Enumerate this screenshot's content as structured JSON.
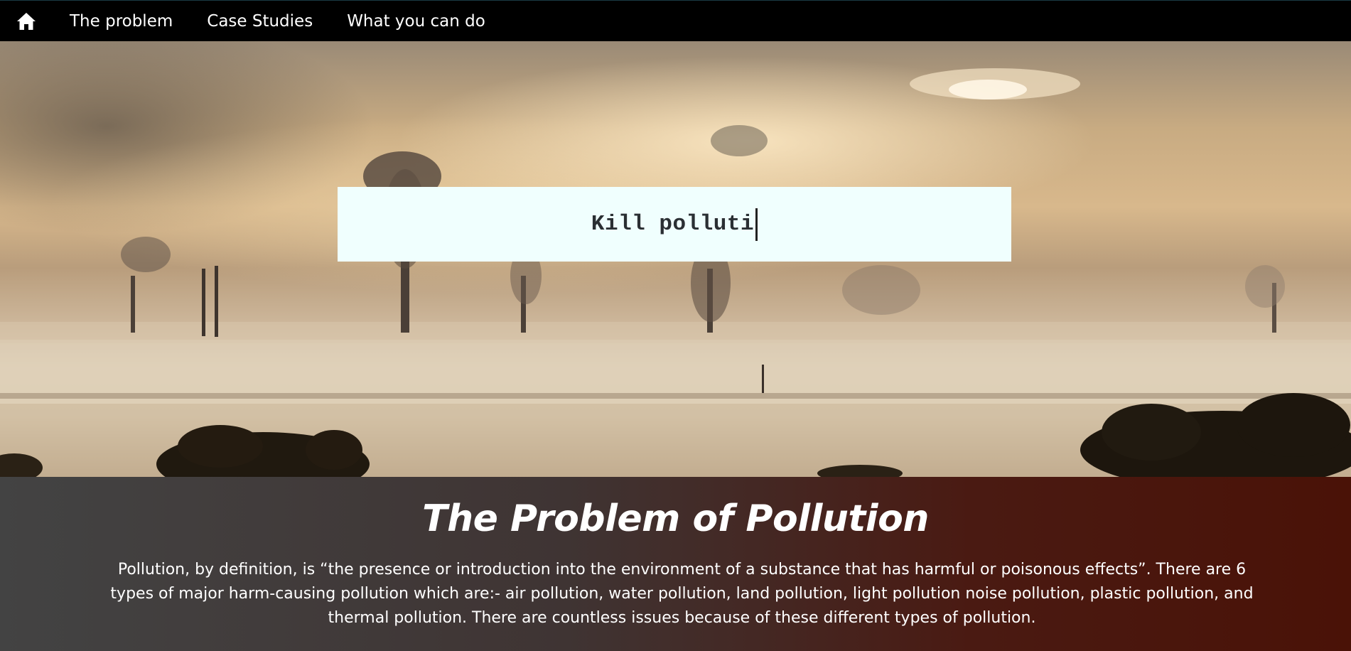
{
  "nav": {
    "home_icon": "home-icon",
    "items": [
      {
        "label": "The problem"
      },
      {
        "label": "Case Studies"
      },
      {
        "label": "What you can do"
      }
    ]
  },
  "hero": {
    "search_value": "Kill polluti"
  },
  "section": {
    "title": "The Problem of Pollution",
    "body": "Pollution, by definition, is “the presence or introduction into the environment of a substance that has harmful or poisonous effects”. There are 6 types of major harm-causing pollution which are:- air pollution, water pollution, land pollution, light pollution noise pollution, plastic pollution, and thermal pollution. There are countless issues because of these different types of pollution."
  },
  "colors": {
    "navbar_bg": "#000000",
    "search_bg": "#f0fffe",
    "content_gradient_start": "#434343",
    "content_gradient_end": "#4a1207"
  }
}
